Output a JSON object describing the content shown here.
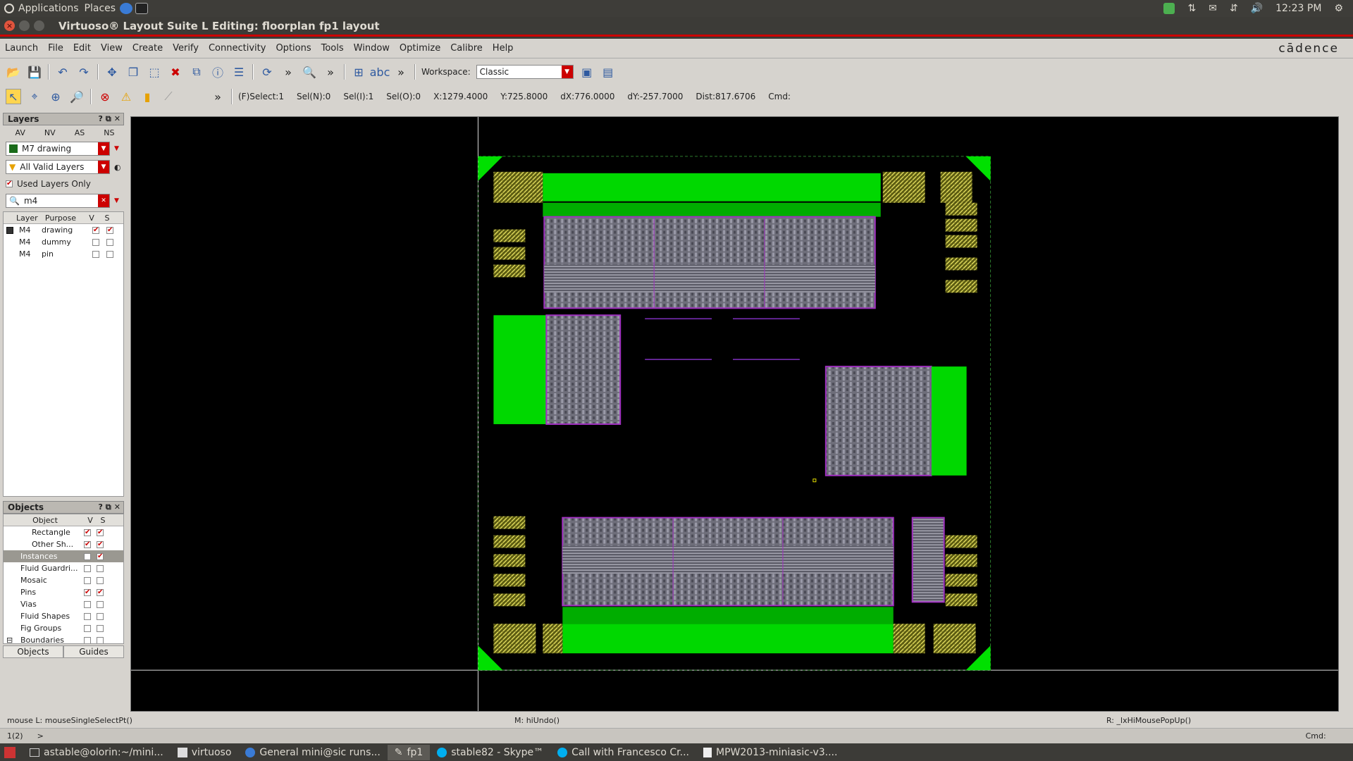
{
  "topbar": {
    "apps": "Applications",
    "places": "Places",
    "time": "12:23 PM"
  },
  "window": {
    "title": "Virtuoso® Layout Suite L Editing: floorplan fp1 layout"
  },
  "menu": [
    "Launch",
    "File",
    "Edit",
    "View",
    "Create",
    "Verify",
    "Connectivity",
    "Options",
    "Tools",
    "Window",
    "Optimize",
    "Calibre",
    "Help"
  ],
  "brand": "cādence",
  "toolbar": {
    "workspace_label": "Workspace:",
    "workspace_value": "Classic"
  },
  "status": {
    "select": "(F)Select:1",
    "seln": "Sel(N):0",
    "seli": "Sel(I):1",
    "selo": "Sel(O):0",
    "x": "X:1279.4000",
    "y": "Y:725.8000",
    "dx": "dX:776.0000",
    "dy": "dY:-257.7000",
    "dist": "Dist:817.6706",
    "cmd": "Cmd:"
  },
  "layers_panel": {
    "title": "Layers",
    "tabs": [
      "AV",
      "NV",
      "AS",
      "NS"
    ],
    "current_layer": "M7 drawing",
    "filter": "All Valid Layers",
    "used_only": "Used Layers Only",
    "search": "m4",
    "columns": [
      "Layer",
      "Purpose",
      "V",
      "S"
    ],
    "rows": [
      {
        "layer": "M4",
        "purpose": "drawing",
        "v": true,
        "s": true
      },
      {
        "layer": "M4",
        "purpose": "dummy",
        "v": false,
        "s": false
      },
      {
        "layer": "M4",
        "purpose": "pin",
        "v": false,
        "s": false
      }
    ]
  },
  "objects_panel": {
    "title": "Objects",
    "columns": [
      "Object",
      "V",
      "S"
    ],
    "rows": [
      {
        "name": "Rectangle",
        "v": true,
        "s": true
      },
      {
        "name": "Other Sh...",
        "v": true,
        "s": true
      },
      {
        "name": "Instances",
        "v": false,
        "s": true
      },
      {
        "name": "Fluid Guardri...",
        "v": false,
        "s": false
      },
      {
        "name": "Mosaic",
        "v": false,
        "s": false
      },
      {
        "name": "Pins",
        "v": true,
        "s": true
      },
      {
        "name": "Vias",
        "v": false,
        "s": false
      },
      {
        "name": "Fluid Shapes",
        "v": false,
        "s": false
      },
      {
        "name": "Fig Groups",
        "v": false,
        "s": false
      },
      {
        "name": "Boundaries",
        "v": false,
        "s": false
      }
    ],
    "tabs": [
      "Objects",
      "Guides"
    ]
  },
  "bottom": {
    "mouse_l": "mouse L: mouseSingleSelectPt()",
    "mouse_m": "M: hiUndo()",
    "mouse_r": "R: _lxHiMousePopUp()",
    "line_no": "1(2)",
    "prompt": ">",
    "cmd": "Cmd:"
  },
  "taskbar": [
    {
      "label": "astable@olorin:~/mini..."
    },
    {
      "label": "virtuoso"
    },
    {
      "label": "General mini@sic runs..."
    },
    {
      "label": "fp1"
    },
    {
      "label": "stable82 - Skype™"
    },
    {
      "label": "Call with Francesco Cr..."
    },
    {
      "label": "MPW2013-miniasic-v3...."
    }
  ]
}
